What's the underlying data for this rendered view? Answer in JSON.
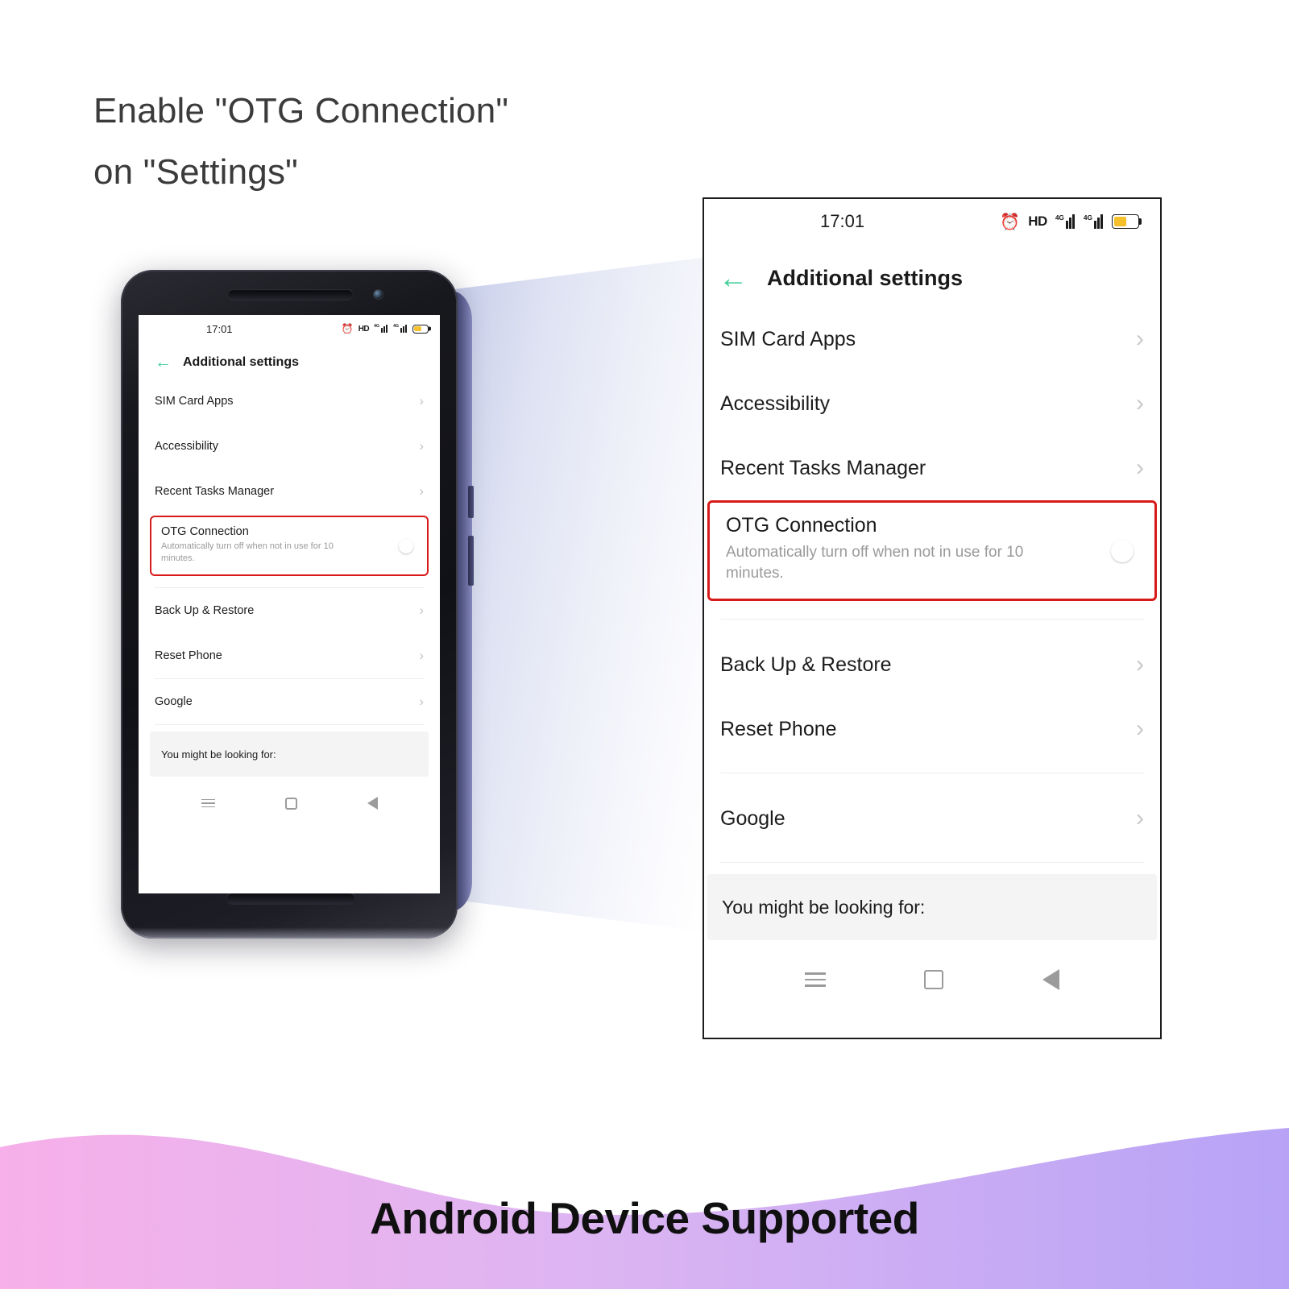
{
  "headline": {
    "line1": "Enable \"OTG Connection\"",
    "line2": "on \"Settings\""
  },
  "banner": {
    "text": "Android Device Supported",
    "gradient_start": "#f7b0e9",
    "gradient_end": "#b7a3f6"
  },
  "colors": {
    "toggle_on": "#23c55f",
    "highlight_border": "#d91a1a",
    "back_arrow": "#3fcf98",
    "battery_fill": "#f5c029"
  },
  "phone_screen": {
    "status_bar": {
      "time": "17:01",
      "alarm_icon": "alarm-clock-icon",
      "hd_label": "HD",
      "signal_1_label": "4G",
      "signal_2_label": "4G",
      "battery_icon": "battery-icon"
    },
    "header": {
      "back_icon": "back-arrow-icon",
      "title": "Additional settings"
    },
    "items": [
      {
        "label": "SIM Card Apps",
        "chevron": "chevron-right-icon"
      },
      {
        "label": "Accessibility",
        "chevron": "chevron-right-icon"
      },
      {
        "label": "Recent Tasks Manager",
        "chevron": "chevron-right-icon"
      },
      {
        "label": "Back Up & Restore",
        "chevron": "chevron-right-icon"
      },
      {
        "label": "Reset Phone",
        "chevron": "chevron-right-icon"
      },
      {
        "label": "Google",
        "chevron": "chevron-right-icon"
      }
    ],
    "otg": {
      "title": "OTG Connection",
      "subtitle": "Automatically turn off when not in use for 10 minutes.",
      "toggle_state": "on"
    },
    "footer": {
      "label": "You might be looking for:"
    },
    "nav": {
      "recents_icon": "recents-menu-icon",
      "home_icon": "home-square-icon",
      "back_icon": "back-triangle-icon"
    }
  },
  "zoom_panel": {
    "status_bar": {
      "time": "17:01",
      "alarm_icon": "alarm-clock-icon",
      "hd_label": "HD",
      "signal_1_label": "4G",
      "signal_2_label": "4G",
      "battery_icon": "battery-icon"
    },
    "header": {
      "back_icon": "back-arrow-icon",
      "title": "Additional settings"
    },
    "items": [
      {
        "label": "SIM Card Apps",
        "chevron": "chevron-right-icon"
      },
      {
        "label": "Accessibility",
        "chevron": "chevron-right-icon"
      },
      {
        "label": "Recent Tasks Manager",
        "chevron": "chevron-right-icon"
      },
      {
        "label": "Back Up & Restore",
        "chevron": "chevron-right-icon"
      },
      {
        "label": "Reset Phone",
        "chevron": "chevron-right-icon"
      },
      {
        "label": "Google",
        "chevron": "chevron-right-icon"
      }
    ],
    "otg": {
      "title": "OTG Connection",
      "subtitle": "Automatically turn off when not in use for 10 minutes.",
      "toggle_state": "on"
    },
    "footer": {
      "label": "You might be looking for:"
    },
    "nav": {
      "recents_icon": "recents-menu-icon",
      "home_icon": "home-square-icon",
      "back_icon": "back-triangle-icon"
    }
  }
}
